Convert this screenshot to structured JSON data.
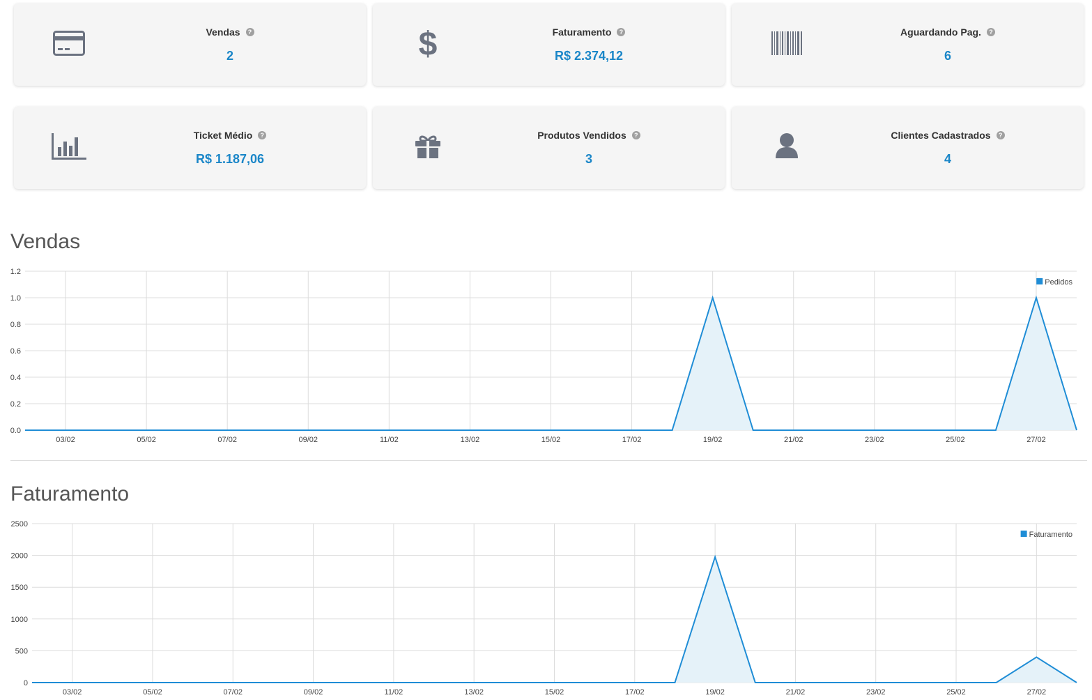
{
  "cards": [
    {
      "label": "Vendas",
      "value": "2",
      "icon": "credit-card-icon"
    },
    {
      "label": "Faturamento",
      "value": "R$ 2.374,12",
      "icon": "dollar-icon"
    },
    {
      "label": "Aguardando Pag.",
      "value": "6",
      "icon": "barcode-icon"
    },
    {
      "label": "Ticket Médio",
      "value": "R$ 1.187,06",
      "icon": "bar-chart-icon"
    },
    {
      "label": "Produtos Vendidos",
      "value": "3",
      "icon": "gift-icon"
    },
    {
      "label": "Clientes Cadastrados",
      "value": "4",
      "icon": "user-icon"
    }
  ],
  "help_glyph": "?",
  "sections": {
    "vendas_title": "Vendas",
    "faturamento_title": "Faturamento"
  },
  "colors": {
    "accent": "#1a86c8",
    "line": "#1f8dd6",
    "fill": "#e5f2f9",
    "icon": "#6b7280"
  },
  "chart_data": [
    {
      "type": "area",
      "title": "Vendas",
      "legend": "top-right",
      "series": [
        {
          "name": "Pedidos"
        }
      ],
      "x": [
        "02/02",
        "03/02",
        "04/02",
        "05/02",
        "06/02",
        "07/02",
        "08/02",
        "09/02",
        "10/02",
        "11/02",
        "12/02",
        "13/02",
        "14/02",
        "15/02",
        "16/02",
        "17/02",
        "18/02",
        "19/02",
        "20/02",
        "21/02",
        "22/02",
        "23/02",
        "24/02",
        "25/02",
        "26/02",
        "27/02",
        "28/02"
      ],
      "values": [
        0,
        0,
        0,
        0,
        0,
        0,
        0,
        0,
        0,
        0,
        0,
        0,
        0,
        0,
        0,
        0,
        0,
        1,
        0,
        0,
        0,
        0,
        0,
        0,
        0,
        1,
        0
      ],
      "x_ticks": [
        "03/02",
        "05/02",
        "07/02",
        "09/02",
        "11/02",
        "13/02",
        "15/02",
        "17/02",
        "19/02",
        "21/02",
        "23/02",
        "25/02",
        "27/02"
      ],
      "y_ticks": [
        "0.0",
        "0.2",
        "0.4",
        "0.6",
        "0.8",
        "1.0",
        "1.2"
      ],
      "ylim": [
        0,
        1.2
      ],
      "grid": true
    },
    {
      "type": "area",
      "title": "Faturamento",
      "legend": "top-right",
      "series": [
        {
          "name": "Faturamento"
        }
      ],
      "x": [
        "02/02",
        "03/02",
        "04/02",
        "05/02",
        "06/02",
        "07/02",
        "08/02",
        "09/02",
        "10/02",
        "11/02",
        "12/02",
        "13/02",
        "14/02",
        "15/02",
        "16/02",
        "17/02",
        "18/02",
        "19/02",
        "20/02",
        "21/02",
        "22/02",
        "23/02",
        "24/02",
        "25/02",
        "26/02",
        "27/02",
        "28/02"
      ],
      "values": [
        0,
        0,
        0,
        0,
        0,
        0,
        0,
        0,
        0,
        0,
        0,
        0,
        0,
        0,
        0,
        0,
        0,
        1975,
        0,
        0,
        0,
        0,
        0,
        0,
        0,
        400,
        0
      ],
      "x_ticks": [
        "03/02",
        "05/02",
        "07/02",
        "09/02",
        "11/02",
        "13/02",
        "15/02",
        "17/02",
        "19/02",
        "21/02",
        "23/02",
        "25/02",
        "27/02"
      ],
      "y_ticks": [
        "0",
        "500",
        "1000",
        "1500",
        "2000",
        "2500"
      ],
      "ylim": [
        0,
        2500
      ],
      "grid": true
    }
  ]
}
